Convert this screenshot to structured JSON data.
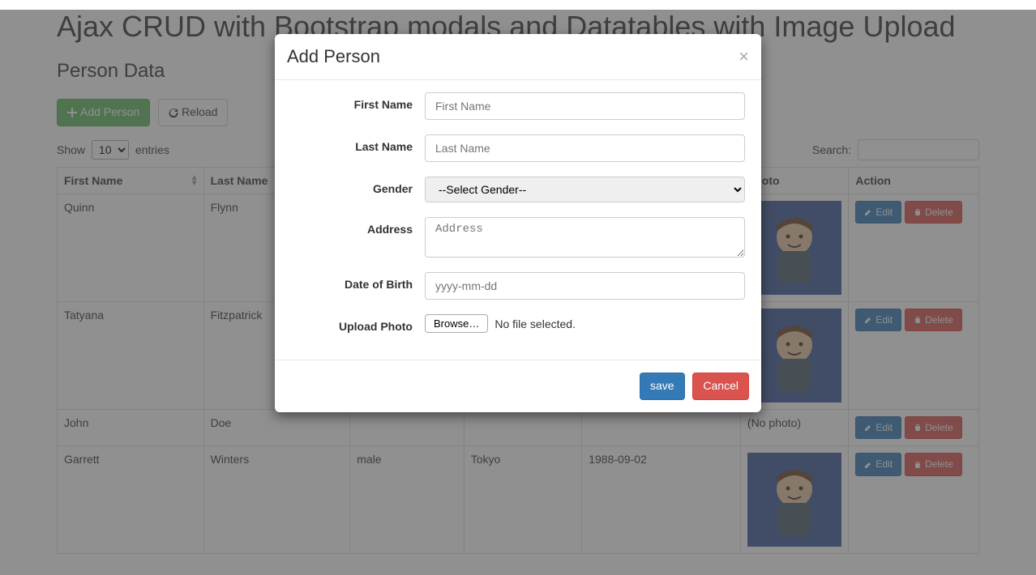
{
  "page": {
    "title": "Ajax CRUD with Bootstrap modals and Datatables with Image Upload",
    "subtitle": "Person Data"
  },
  "toolbar": {
    "add_label": "Add Person",
    "reload_label": "Reload"
  },
  "datatable": {
    "show_label": "Show",
    "show_value": "10",
    "entries_label": "entries",
    "search_label": "Search:",
    "columns": {
      "first_name": "First Name",
      "last_name": "Last Name",
      "gender": "",
      "address": "",
      "dob": "",
      "photo": "Photo",
      "action": "Action"
    },
    "row_actions": {
      "edit": "Edit",
      "delete": "Delete"
    },
    "rows": [
      {
        "first_name": "Quinn",
        "last_name": "Flynn",
        "gender": "",
        "address": "",
        "dob": "",
        "has_photo": true,
        "no_photo_text": ""
      },
      {
        "first_name": "Tatyana",
        "last_name": "Fitzpatrick",
        "gender": "",
        "address": "",
        "dob": "",
        "has_photo": true,
        "no_photo_text": ""
      },
      {
        "first_name": "John",
        "last_name": "Doe",
        "gender": "",
        "address": "",
        "dob": "",
        "has_photo": false,
        "no_photo_text": "(No photo)"
      },
      {
        "first_name": "Garrett",
        "last_name": "Winters",
        "gender": "male",
        "address": "Tokyo",
        "dob": "1988-09-02",
        "has_photo": true,
        "no_photo_text": ""
      }
    ]
  },
  "modal": {
    "title": "Add Person",
    "fields": {
      "first_name": {
        "label": "First Name",
        "placeholder": "First Name"
      },
      "last_name": {
        "label": "Last Name",
        "placeholder": "Last Name"
      },
      "gender": {
        "label": "Gender",
        "placeholder": "--Select Gender--"
      },
      "address": {
        "label": "Address",
        "placeholder": "Address"
      },
      "dob": {
        "label": "Date of Birth",
        "placeholder": "yyyy-mm-dd"
      },
      "photo": {
        "label": "Upload Photo",
        "browse": "Browse…",
        "status": "No file selected."
      }
    },
    "buttons": {
      "save": "save",
      "cancel": "Cancel"
    }
  }
}
